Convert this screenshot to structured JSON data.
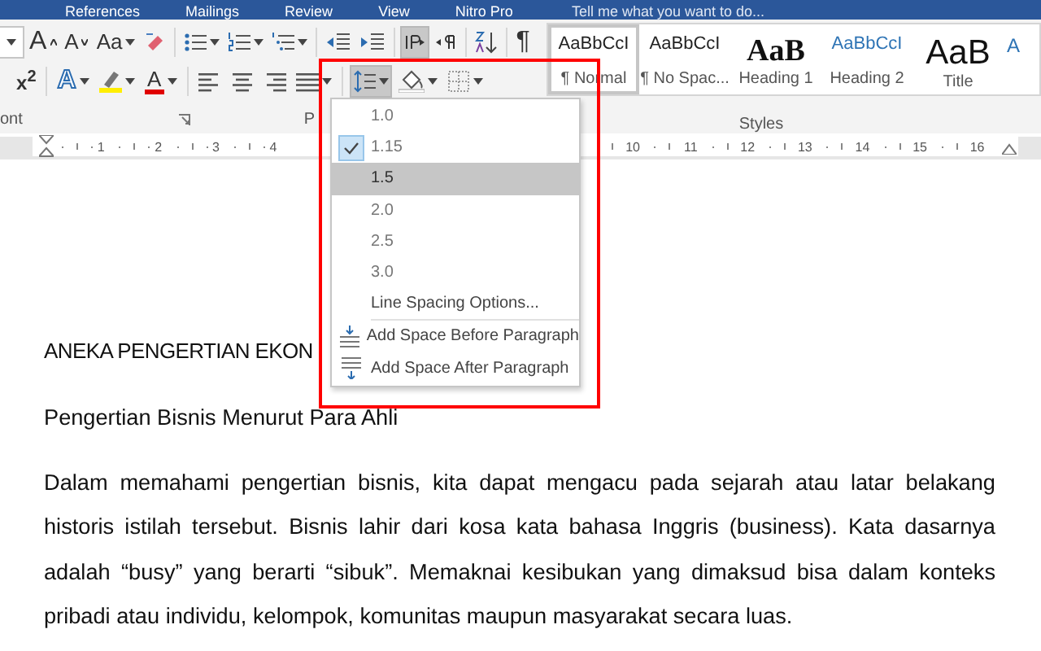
{
  "title_bar": {
    "tabs": [
      "References",
      "Mailings",
      "Review",
      "View",
      "Nitro Pro"
    ],
    "tell_me": "Tell me what you want to do..."
  },
  "ribbon": {
    "grow_font": "A",
    "shrink_font": "A",
    "change_case": "Aa",
    "show_marks": "¶",
    "superscript": "x$^{2}$",
    "text_effects": "A",
    "font_color": "A",
    "direction_buttons": [
      {
        "kind": "ltr",
        "selected": true
      },
      {
        "kind": "rtl",
        "selected": false
      }
    ],
    "line_spacing_button": {
      "expanded": true
    },
    "group_labels": {
      "font": "ont",
      "paragraph": "P",
      "styles": "Styles"
    }
  },
  "styles": [
    {
      "kind": "normal",
      "sample": "AaBbCcI",
      "name": "¶ Normal",
      "selected": true
    },
    {
      "kind": "normal",
      "sample": "AaBbCcI",
      "name": "¶ No Spac...",
      "selected": false
    },
    {
      "kind": "heading1",
      "sample": "AaB",
      "name": "Heading 1",
      "selected": false
    },
    {
      "kind": "heading2",
      "sample": "AaBbCcI",
      "name": "Heading 2",
      "selected": false
    },
    {
      "kind": "title",
      "sample": "AaB",
      "name": "Title",
      "selected": false
    },
    {
      "kind": "cut",
      "sample": "A",
      "selected": false
    }
  ],
  "ruler": {
    "left_numbers": [
      "1",
      "2",
      "3",
      "4"
    ],
    "right_numbers": [
      "10",
      "11",
      "12",
      "13",
      "14",
      "15",
      "16"
    ]
  },
  "line_spacing_menu": [
    {
      "kind": "value",
      "label": "1.0",
      "checked": false,
      "selected": false
    },
    {
      "kind": "value",
      "label": "1.15",
      "checked": true,
      "selected": false
    },
    {
      "kind": "value",
      "label": "1.5",
      "checked": false,
      "selected": true
    },
    {
      "kind": "value",
      "label": "2.0",
      "checked": false,
      "selected": false
    },
    {
      "kind": "value",
      "label": "2.5",
      "checked": false,
      "selected": false
    },
    {
      "kind": "value",
      "label": "3.0",
      "checked": false,
      "selected": false
    },
    {
      "kind": "option",
      "label": "Line Spacing Options...",
      "selected": false
    },
    {
      "kind": "before",
      "label": "Add Space Before Paragraph",
      "selected": false
    },
    {
      "kind": "after",
      "label": "Add Space After Paragraph",
      "selected": false
    }
  ],
  "document": {
    "heading": "ANEKA PENGERTIAN EKON",
    "subheading": "Pengertian Bisnis Menurut Para Ahli",
    "paragraph": "Dalam memahami pengertian bisnis, kita dapat mengacu pada sejarah atau latar belakang historis istilah tersebut. Bisnis lahir dari kosa kata bahasa Inggris (business). Kata dasarnya adalah “busy” yang berarti “sibuk”. Memaknai kesibukan yang dimaksud bisa dalam konteks pribadi atau individu, kelompok, komunitas maupun masyarakat secara luas."
  }
}
